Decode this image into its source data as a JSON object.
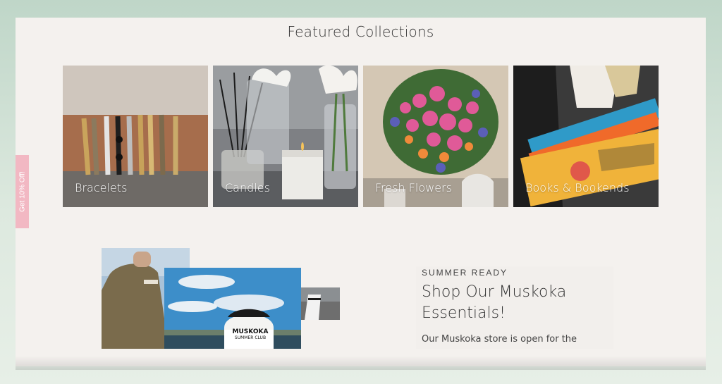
{
  "featured": {
    "title": "Featured Collections",
    "tiles": [
      {
        "label": "Bracelets"
      },
      {
        "label": "Candles"
      },
      {
        "label": "Fresh Flowers"
      },
      {
        "label": "Books & Bookends"
      }
    ]
  },
  "side_tab": {
    "label": "Get 10% Off!",
    "color": "#f2b8c3"
  },
  "promo": {
    "eyebrow": "SUMMER READY",
    "heading": "Shop Our Muskoka Essentials!",
    "body": "Our Muskoka store is open for the",
    "hat_text_line1": "MUSKOKA",
    "hat_text_line2": "SUMMER CLUB"
  },
  "colors": {
    "page_bg": "#f4f1ee",
    "outer_bg": "#c8ddd0",
    "text": "#333333"
  }
}
